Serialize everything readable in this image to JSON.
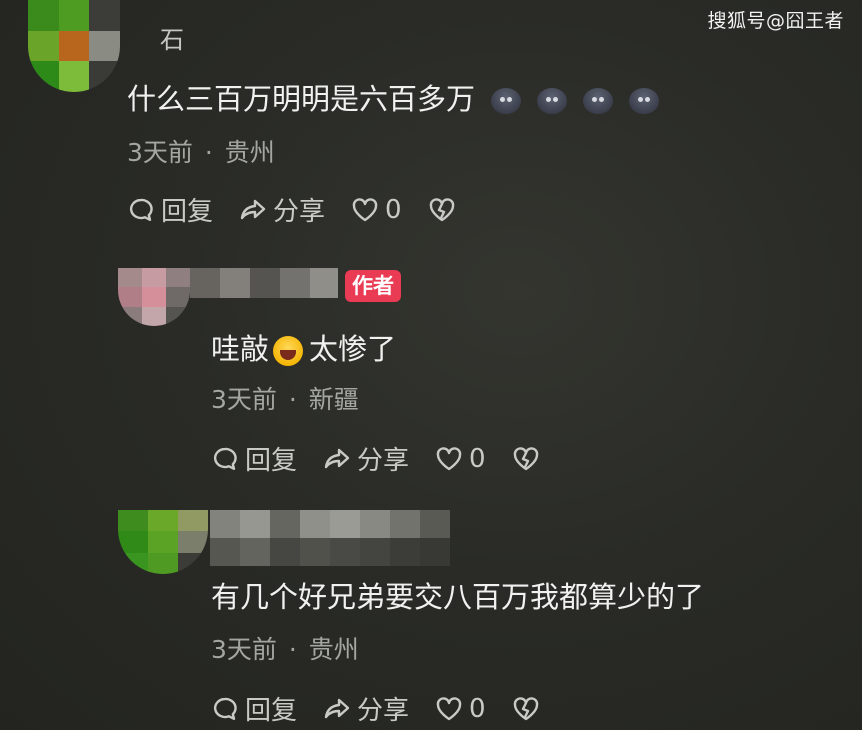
{
  "watermark": "搜狐号@囧王者",
  "colors": {
    "author_badge": "#e93b54",
    "background": "#2a2b27"
  },
  "comments": [
    {
      "name_fragment": "石",
      "text": "什么三百万明明是六百多万",
      "emoji_count": 4,
      "emoji_icon": "sad-face-emoji-icon",
      "time": "3天前",
      "sep": "·",
      "location": "贵州",
      "reply_label": "回复",
      "share_label": "分享",
      "like_count": "0"
    },
    {
      "author_badge": "作者",
      "text_before": "哇敲",
      "emoji_icon": "laughing-crying-emoji-icon",
      "text_after": "太惨了",
      "time": "3天前",
      "sep": "·",
      "location": "新疆",
      "reply_label": "回复",
      "share_label": "分享",
      "like_count": "0"
    },
    {
      "text": "有几个好兄弟要交八百万我都算少的了",
      "time": "3天前",
      "sep": "·",
      "location": "贵州",
      "reply_label": "回复",
      "share_label": "分享",
      "like_count": "0"
    }
  ]
}
